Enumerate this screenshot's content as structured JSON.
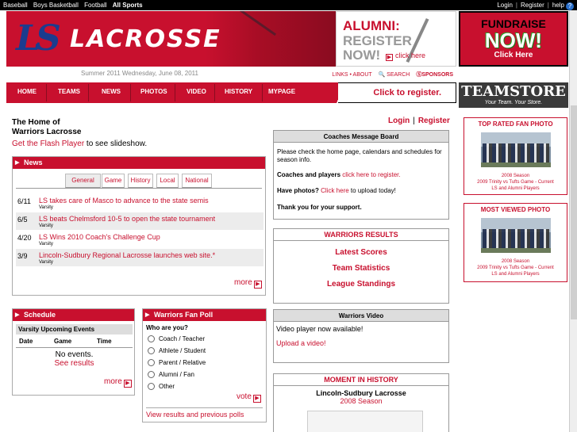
{
  "topbar": {
    "left": [
      "Baseball",
      "Boys Basketball",
      "Football",
      "All Sports"
    ],
    "login": "Login",
    "register": "Register",
    "help": "help",
    "help_icon": "?"
  },
  "header": {
    "title": "LACROSSE",
    "logo_text": "LS",
    "alumni": {
      "line1": "ALUMNI:",
      "line2": "REGISTER",
      "line3": "NOW!",
      "click": "click here"
    },
    "fundraise": {
      "line1": "FUNDRAISE",
      "line2": "NOW!",
      "line3": "Click Here"
    },
    "date": "Summer 2011   Wednesday, June 08, 2011",
    "links": "LINKS • ABOUT",
    "search": "SEARCH",
    "sponsors": "SPONSORS"
  },
  "nav": {
    "items": [
      "HOME",
      "TEAMS",
      "NEWS",
      "PHOTOS",
      "VIDEO",
      "HISTORY",
      "MYPAGE"
    ],
    "register": "Click to register.",
    "teamstore": "TEAMSTORE",
    "teamstore_tag": "Your Team. Your Store."
  },
  "intro": {
    "home_line1": "The Home of",
    "home_line2": "Warriors Lacrosse",
    "flash_link": "Get the Flash Player",
    "flash_text": " to see slideshow."
  },
  "news": {
    "title": "News",
    "tabs": [
      "General",
      "Game",
      "History",
      "Local",
      "National"
    ],
    "rows": [
      {
        "date": "6/11",
        "headline": "LS takes care of Masco to advance to the state semis",
        "sub": "Varsity"
      },
      {
        "date": "6/5",
        "headline": "LS beats Chelmsford 10-5 to open the state tournament",
        "sub": "Varsity"
      },
      {
        "date": "4/20",
        "headline": "LS Wins 2010 Coach's Challenge Cup",
        "sub": "Varsity"
      },
      {
        "date": "3/9",
        "headline": "Lincoln-Sudbury Regional Lacrosse launches web site.*",
        "sub": "Varsity"
      }
    ],
    "more": "more"
  },
  "schedule": {
    "title": "Schedule",
    "sub": "Varsity Upcoming Events",
    "cols": [
      "Date",
      "Game",
      "Time"
    ],
    "none": "No events.",
    "results": "See results",
    "more": "more"
  },
  "poll": {
    "title": "Warriors Fan Poll",
    "question": "Who are you?",
    "options": [
      "Coach / Teacher",
      "Athlete / Student",
      "Parent / Relative",
      "Alumni / Fan",
      "Other"
    ],
    "vote": "vote",
    "view": "View results and previous polls"
  },
  "login": {
    "login": "Login",
    "sep": "|",
    "register": "Register"
  },
  "coach": {
    "title": "Coaches Message Board",
    "p1": "Please check the home page, calendars and schedules for season info.",
    "p2a": "Coaches and players ",
    "p2b": "click here to register.",
    "p3a": "Have photos? ",
    "p3b": "Click here",
    "p3c": " to upload today!",
    "p4": "Thank you for your support."
  },
  "results": {
    "title": "WARRIORS RESULTS",
    "links": [
      "Latest Scores",
      "Team Statistics",
      "League Standings"
    ]
  },
  "video": {
    "title": "Warriors Video",
    "line1": "Video player now available!",
    "line2": "Upload a video!"
  },
  "moment": {
    "title": "MOMENT IN HISTORY",
    "name": "Lincoln-Sudbury Lacrosse",
    "season": "2008 Season"
  },
  "top_rated": {
    "title": "TOP RATED FAN PHOTO",
    "cap1": "2008 Season",
    "cap2": "2009 Trinity vs Tufts Game - Current",
    "cap3": "LS and Alumni Players"
  },
  "most_viewed": {
    "title": "MOST VIEWED PHOTO",
    "cap1": "2008 Season",
    "cap2": "2009 Trinity vs Tufts Game - Current",
    "cap3": "LS and Alumni Players"
  },
  "colors": {
    "accent": "#c8102e",
    "navy": "#1b3c8f",
    "bar": "#000000"
  }
}
